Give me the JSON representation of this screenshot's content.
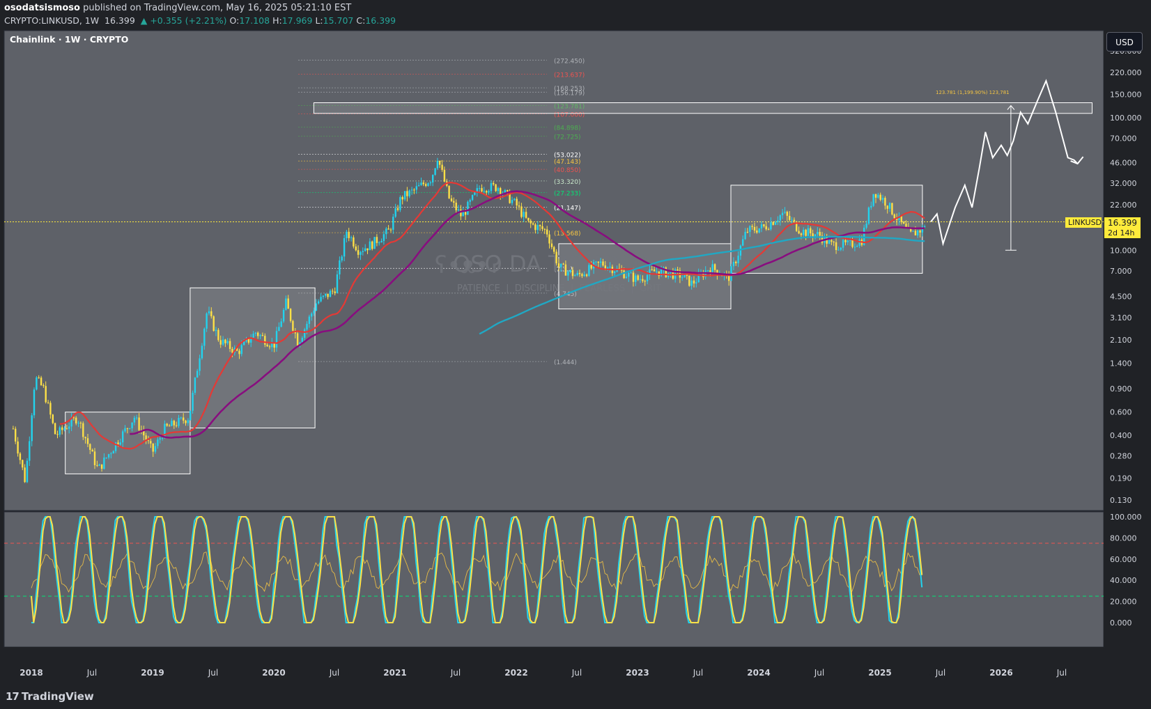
{
  "header": {
    "publisher": "osodatsismoso",
    "published_text": "published on TradingView.com, May 16, 2025 05:21:10 EST",
    "symbol": "CRYPTO:LINKUSD, 1W",
    "price": "16.399",
    "change": "▲ +0.355 (+2.21%)",
    "o_label": "O:",
    "o_value": "17.108",
    "h_label": "H:",
    "h_value": "17.969",
    "l_label": "L:",
    "l_value": "15.707",
    "c_label": "C:",
    "c_value": "16.399"
  },
  "chart_title": "Chainlink · 1W · CRYPTO",
  "currency_button": "USD",
  "watermark": {
    "name": "OSO DA TISMOSO",
    "tagline": "PATIENCE  |  DISCIPLINE  |  FEARLESS  |  GRIT"
  },
  "price_badge": {
    "symbol": "LINKUSD",
    "price": "16.399",
    "countdown": "2d 14h"
  },
  "projection_label": "123.781 (1,199.90%) 123,781",
  "footer": {
    "brand": "TradingView"
  },
  "colors": {
    "background": "#202226",
    "pane": "#5e6168",
    "up_candle": "#22d3ee",
    "down_candle": "#fde047",
    "ma_red": "#e53935",
    "ma_purple": "#880e7f",
    "ma_teal": "#20a8c4",
    "stoch_k": "#22d3ee",
    "stoch_d": "#fde047",
    "rsi": "#f5c542",
    "level_upper": "#ef5350",
    "level_lower": "#00e676"
  },
  "chart_data": {
    "type": "candlestick",
    "scale": "log",
    "y_axis_ticks": [
      "320.000",
      "220.000",
      "150.000",
      "100.000",
      "70.000",
      "46.000",
      "32.000",
      "22.000",
      "15.000",
      "10.000",
      "7.000",
      "4.500",
      "3.100",
      "2.100",
      "1.400",
      "0.900",
      "0.600",
      "0.400",
      "0.280",
      "0.190",
      "0.130"
    ],
    "y_axis_values": [
      320,
      220,
      150,
      100,
      70,
      46,
      32,
      22,
      15,
      10,
      7,
      4.5,
      3.1,
      2.1,
      1.4,
      0.9,
      0.6,
      0.4,
      0.28,
      0.19,
      0.13
    ],
    "x_axis_ticks": [
      "2018",
      "Jul",
      "2019",
      "Jul",
      "2020",
      "Jul",
      "2021",
      "Jul",
      "2022",
      "Jul",
      "2023",
      "Jul",
      "2024",
      "Jul",
      "2025",
      "Jul",
      "2026",
      "Jul"
    ],
    "x_axis_dates": [
      2018.0,
      2018.5,
      2019.0,
      2019.5,
      2020.0,
      2020.5,
      2021.0,
      2021.5,
      2022.0,
      2022.5,
      2023.0,
      2023.5,
      2024.0,
      2024.5,
      2025.0,
      2025.5,
      2026.0,
      2026.5
    ],
    "current_price": 16.399,
    "fib_levels": [
      {
        "label": "(272.450)",
        "value": 272.45,
        "color": "#b0b3b8"
      },
      {
        "label": "(213.637)",
        "value": 213.637,
        "color": "#ef5350"
      },
      {
        "label": "(168.253)",
        "value": 168.253,
        "color": "#b0b3b8"
      },
      {
        "label": "(156.179)",
        "value": 156.179,
        "color": "#b0b3b8"
      },
      {
        "label": "(123.781)",
        "value": 123.781,
        "color": "#4caf50"
      },
      {
        "label": "(107.000)",
        "value": 107,
        "color": "#ef5350"
      },
      {
        "label": "(84.898)",
        "value": 84.898,
        "color": "#4caf50"
      },
      {
        "label": "(72.725)",
        "value": 72.725,
        "color": "#4caf50"
      },
      {
        "label": "(53.022)",
        "value": 53.022,
        "color": "#ffffff"
      },
      {
        "label": "(47.143)",
        "value": 47.143,
        "color": "#f5c542"
      },
      {
        "label": "(40.850)",
        "value": 40.85,
        "color": "#ef5350"
      },
      {
        "label": "(33.320)",
        "value": 33.32,
        "color": "#c8e6c9"
      },
      {
        "label": "(27.233)",
        "value": 27.233,
        "color": "#00e676"
      },
      {
        "label": "(21.147)",
        "value": 21.147,
        "color": "#ffffff"
      },
      {
        "label": "(13.568)",
        "value": 13.568,
        "color": "#f5c542"
      },
      {
        "label": "(7.3..)",
        "value": 7.3,
        "color": "#ffffff"
      },
      {
        "label": "(4.745)",
        "value": 4.745,
        "color": "#b0b3b8"
      },
      {
        "label": "(1.444)",
        "value": 1.444,
        "color": "#b0b3b8"
      }
    ],
    "consolidation_boxes": [
      {
        "x0": 2018.28,
        "x1": 2019.31,
        "low": 0.205,
        "high": 0.6
      },
      {
        "x0": 2019.31,
        "x1": 2020.34,
        "low": 0.455,
        "high": 5.2
      },
      {
        "x0": 2022.35,
        "x1": 2023.77,
        "low": 3.6,
        "high": 11.2
      },
      {
        "x0": 2023.77,
        "x1": 2025.35,
        "low": 6.7,
        "high": 31
      },
      {
        "x0": 2020.33,
        "x1": 2026.75,
        "low": 108,
        "high": 130
      }
    ],
    "price_keypoints": [
      [
        2017.85,
        0.45
      ],
      [
        2017.95,
        0.18
      ],
      [
        2018.03,
        1.1
      ],
      [
        2018.1,
        0.9
      ],
      [
        2018.2,
        0.4
      ],
      [
        2018.38,
        0.55
      ],
      [
        2018.55,
        0.22
      ],
      [
        2018.7,
        0.35
      ],
      [
        2018.85,
        0.55
      ],
      [
        2019.0,
        0.3
      ],
      [
        2019.1,
        0.45
      ],
      [
        2019.3,
        0.55
      ],
      [
        2019.45,
        3.5
      ],
      [
        2019.55,
        2.1
      ],
      [
        2019.7,
        1.7
      ],
      [
        2019.85,
        2.4
      ],
      [
        2020.0,
        1.9
      ],
      [
        2020.1,
        4.0
      ],
      [
        2020.2,
        2.0
      ],
      [
        2020.35,
        4.0
      ],
      [
        2020.5,
        5.0
      ],
      [
        2020.6,
        14.0
      ],
      [
        2020.7,
        10.0
      ],
      [
        2020.8,
        11.0
      ],
      [
        2020.95,
        14.0
      ],
      [
        2021.05,
        25.0
      ],
      [
        2021.15,
        28.0
      ],
      [
        2021.3,
        35.0
      ],
      [
        2021.35,
        51.0
      ],
      [
        2021.45,
        24.0
      ],
      [
        2021.55,
        18.0
      ],
      [
        2021.7,
        30.0
      ],
      [
        2021.85,
        30.0
      ],
      [
        2022.0,
        22.0
      ],
      [
        2022.1,
        16.0
      ],
      [
        2022.25,
        14.0
      ],
      [
        2022.35,
        7.5
      ],
      [
        2022.5,
        6.4
      ],
      [
        2022.7,
        8.0
      ],
      [
        2022.85,
        7.0
      ],
      [
        2023.0,
        6.0
      ],
      [
        2023.15,
        7.0
      ],
      [
        2023.35,
        6.5
      ],
      [
        2023.45,
        5.6
      ],
      [
        2023.6,
        7.5
      ],
      [
        2023.75,
        6.2
      ],
      [
        2023.8,
        8.0
      ],
      [
        2023.9,
        14.0
      ],
      [
        2024.05,
        15.0
      ],
      [
        2024.2,
        19.0
      ],
      [
        2024.35,
        14.0
      ],
      [
        2024.5,
        13.0
      ],
      [
        2024.6,
        11.0
      ],
      [
        2024.75,
        11.0
      ],
      [
        2024.85,
        12.0
      ],
      [
        2024.95,
        28.0
      ],
      [
        2025.05,
        23.0
      ],
      [
        2025.15,
        17.0
      ],
      [
        2025.25,
        13.0
      ],
      [
        2025.35,
        14.5
      ],
      [
        2025.38,
        16.4
      ]
    ],
    "projection_path": [
      [
        2025.42,
        16.4
      ],
      [
        2025.47,
        18.8
      ],
      [
        2025.52,
        11.2
      ],
      [
        2025.62,
        21
      ],
      [
        2025.7,
        31
      ],
      [
        2025.76,
        21
      ],
      [
        2025.82,
        42
      ],
      [
        2025.87,
        78
      ],
      [
        2025.93,
        50
      ],
      [
        2026.0,
        62
      ],
      [
        2026.05,
        52
      ],
      [
        2026.1,
        67
      ],
      [
        2026.16,
        110
      ],
      [
        2026.22,
        90
      ],
      [
        2026.3,
        135
      ],
      [
        2026.37,
        190
      ],
      [
        2026.45,
        110
      ],
      [
        2026.55,
        50
      ],
      [
        2026.6,
        48
      ],
      [
        2026.63,
        45
      ]
    ],
    "projection_measure": {
      "x": 2026.08,
      "low": 10,
      "high": 123.781
    },
    "indicator": {
      "name": "Stoch RSI",
      "y_axis_ticks": [
        "100.000",
        "80.000",
        "60.000",
        "40.000",
        "20.000",
        "0.000"
      ],
      "y_axis_values": [
        100,
        80,
        60,
        40,
        20,
        0
      ],
      "upper_band": 75,
      "lower_band": 25
    }
  }
}
